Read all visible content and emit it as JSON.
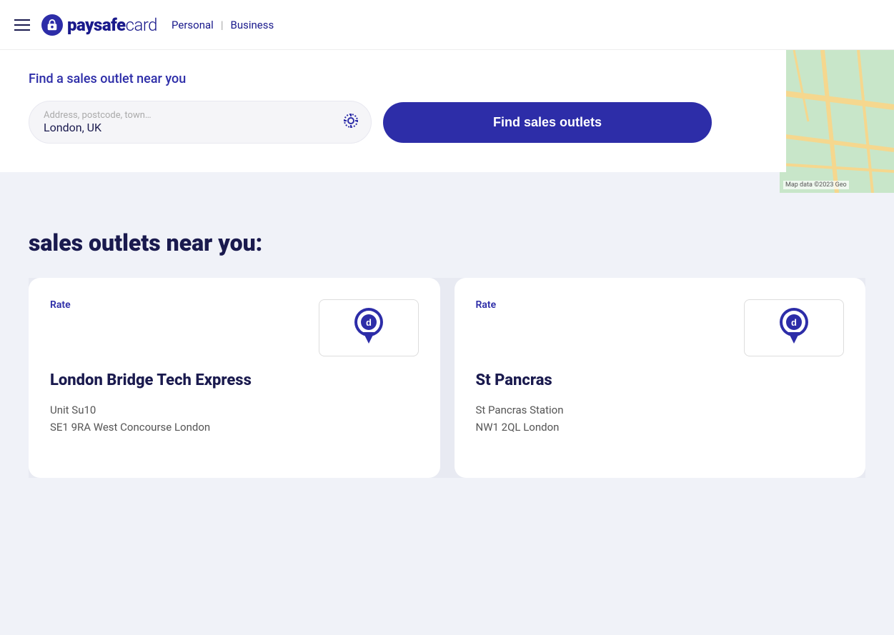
{
  "header": {
    "menu_label": "Menu",
    "logo_text_bold": "paysafe",
    "logo_text_light": "card",
    "nav_personal": "Personal",
    "nav_separator": "|",
    "nav_business": "Business"
  },
  "search": {
    "title": "Find a sales outlet near you",
    "input_placeholder": "Address, postcode, town…",
    "input_value": "London, UK",
    "button_label": "Find sales outlets"
  },
  "map": {
    "watermark": "Map data ©2023 Geo"
  },
  "results": {
    "heading": "sales outlets near you:"
  },
  "outlets": [
    {
      "rate_label": "Rate",
      "name": "London Bridge Tech Express",
      "address_line1": "Unit Su10",
      "address_line2": "SE1 9RA West Concourse London"
    },
    {
      "rate_label": "Rate",
      "name": "St Pancras",
      "address_line1": "St Pancras Station",
      "address_line2": "NW1 2QL London"
    }
  ]
}
